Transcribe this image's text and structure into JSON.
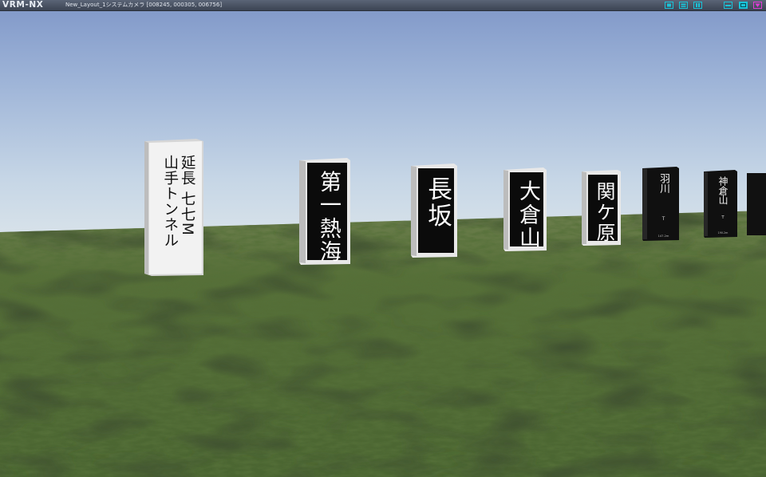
{
  "app": {
    "logo": "VRM-NX",
    "window_title": "New_Layout_1システムカメラ  [008245, 000305, 006756]"
  },
  "toolbar": {
    "left_group": [
      "view-icon-1",
      "view-icon-2",
      "view-icon-3"
    ],
    "right_group": [
      "minimize-icon",
      "maximize-icon",
      "menu-down-icon"
    ],
    "colors": {
      "left_group": "#19c3d8",
      "minimize": "#19c3d8",
      "maximize": "#19c3d8",
      "menu": "#e23ad6"
    }
  },
  "scene": {
    "colors": {
      "sky_top": "#7f97c8",
      "sky_horizon": "#d9e3ea",
      "ground": "#4e6b33",
      "sign_white": "#eeeeee",
      "sign_black": "#0b0b0b"
    },
    "signs": [
      {
        "id": "yamate-tunnel",
        "style": "white",
        "lines": [
          "延長 七七M",
          "山手トンネル"
        ]
      },
      {
        "id": "daiichi-atami",
        "style": "black",
        "text": "第一熱海"
      },
      {
        "id": "nagasaka",
        "style": "black",
        "text": "長坂"
      },
      {
        "id": "ookurayama",
        "style": "black",
        "text": "大倉山"
      },
      {
        "id": "sekigahara",
        "style": "black",
        "text": "関ケ原"
      },
      {
        "id": "hanegawa",
        "style": "dark",
        "text": "羽川",
        "sub": "T",
        "foot": "147.2m"
      },
      {
        "id": "kamikurayama",
        "style": "dark",
        "text": "神倉山",
        "sub": "T",
        "foot": "190.2m"
      }
    ]
  }
}
